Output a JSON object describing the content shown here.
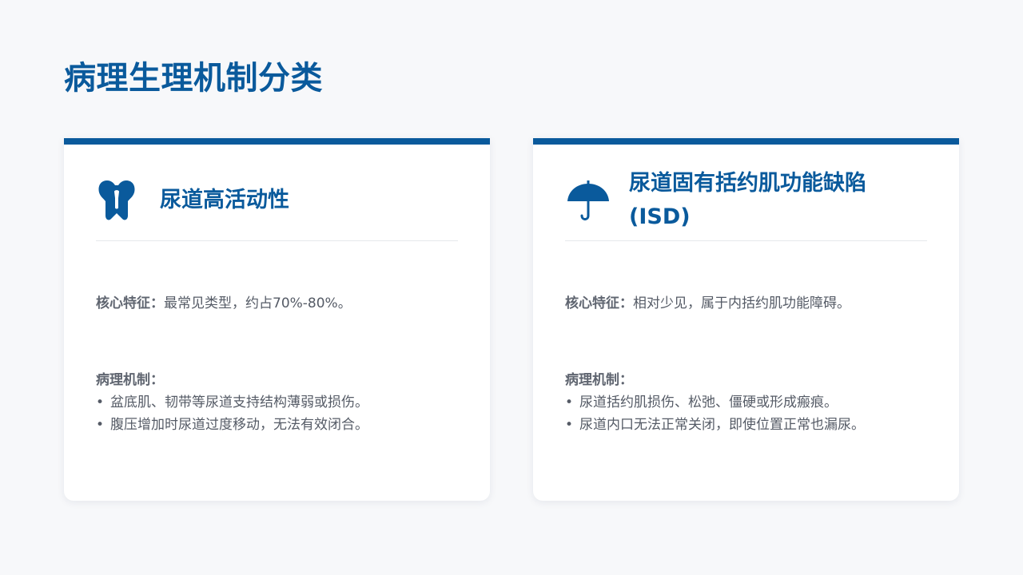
{
  "page": {
    "title": "病理生理机制分类"
  },
  "colors": {
    "accent": "#0a5a9c",
    "background": "#f7f8fa",
    "card": "#ffffff",
    "text": "#555b66"
  },
  "cards": [
    {
      "icon": "bladder-icon",
      "title": "尿道高活动性",
      "feature_label": "核心特征：",
      "feature_text": "最常见类型，约占70%-80%。",
      "mechanism_label": "病理机制：",
      "mechanisms": [
        "盆底肌、韧带等尿道支持结构薄弱或损伤。",
        "腹压增加时尿道过度移动，无法有效闭合。"
      ]
    },
    {
      "icon": "umbrella-icon",
      "title": "尿道固有括约肌功能缺陷 (ISD)",
      "feature_label": "核心特征：",
      "feature_text": "相对少见，属于内括约肌功能障碍。",
      "mechanism_label": "病理机制：",
      "mechanisms": [
        "尿道括约肌损伤、松弛、僵硬或形成瘢痕。",
        "尿道内口无法正常关闭，即使位置正常也漏尿。"
      ]
    }
  ]
}
